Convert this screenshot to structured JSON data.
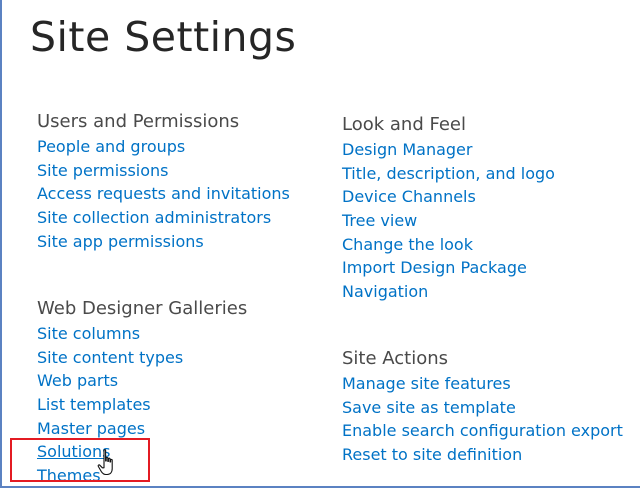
{
  "page": {
    "title": "Site Settings"
  },
  "sections": {
    "users_permissions": {
      "heading": "Users and Permissions",
      "links": [
        "People and groups",
        "Site permissions",
        "Access requests and invitations",
        "Site collection administrators",
        "Site app permissions"
      ]
    },
    "web_designer_galleries": {
      "heading": "Web Designer Galleries",
      "links": [
        "Site columns",
        "Site content types",
        "Web parts",
        "List templates",
        "Master pages",
        "Solutions",
        "Themes"
      ]
    },
    "look_and_feel": {
      "heading": "Look and Feel",
      "links": [
        "Design Manager",
        "Title, description, and logo",
        "Device Channels",
        "Tree view",
        "Change the look",
        "Import Design Package",
        "Navigation"
      ]
    },
    "site_actions": {
      "heading": "Site Actions",
      "links": [
        "Manage site features",
        "Save site as template",
        "Enable search configuration export",
        "Reset to site definition"
      ]
    }
  },
  "state": {
    "hovered_link": "Solutions",
    "highlighted_links": [
      "Solutions",
      "Themes"
    ],
    "cursor_icon": "hand-pointer-icon"
  },
  "colors": {
    "link": "#0072c6",
    "heading": "#4a4a4a",
    "title": "#262626",
    "highlight_border": "#e31b23",
    "frame_border": "#5b82c2"
  }
}
